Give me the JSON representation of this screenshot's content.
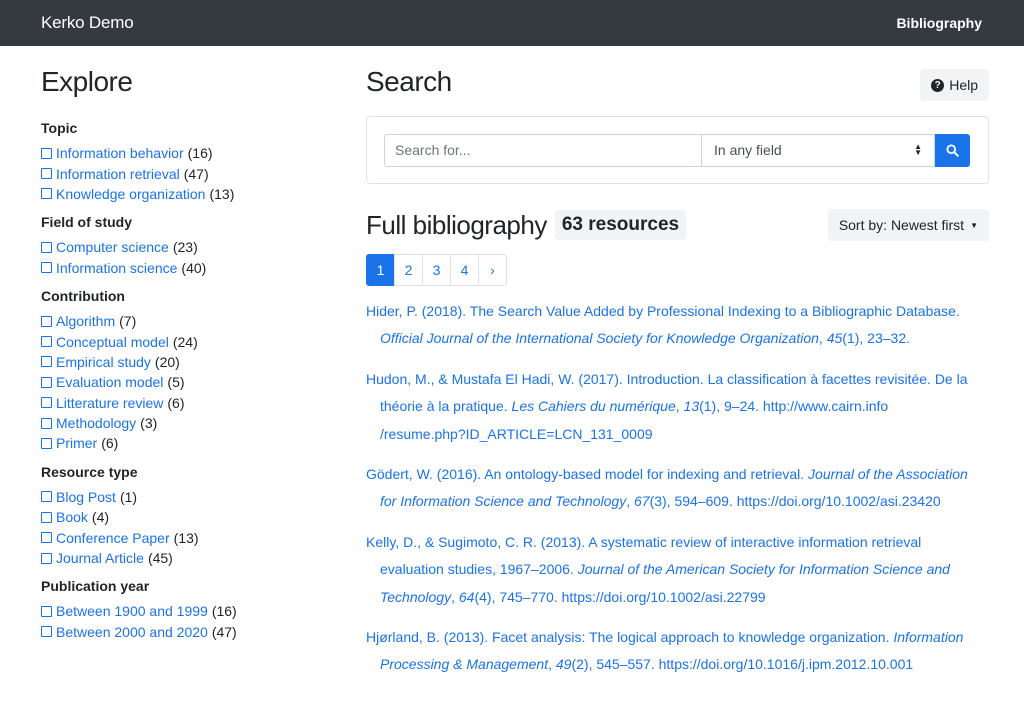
{
  "navbar": {
    "brand": "Kerko Demo",
    "link": "Bibliography"
  },
  "sidebar": {
    "title": "Explore",
    "facets": [
      {
        "title": "Topic",
        "items": [
          {
            "label": "Information behavior",
            "count": "(16)"
          },
          {
            "label": "Information retrieval",
            "count": "(47)"
          },
          {
            "label": "Knowledge organization",
            "count": "(13)"
          }
        ]
      },
      {
        "title": "Field of study",
        "items": [
          {
            "label": "Computer science",
            "count": "(23)"
          },
          {
            "label": "Information science",
            "count": "(40)"
          }
        ]
      },
      {
        "title": "Contribution",
        "items": [
          {
            "label": "Algorithm",
            "count": "(7)"
          },
          {
            "label": "Conceptual model",
            "count": "(24)"
          },
          {
            "label": "Empirical study",
            "count": "(20)"
          },
          {
            "label": "Evaluation model",
            "count": "(5)"
          },
          {
            "label": "Litterature review",
            "count": "(6)"
          },
          {
            "label": "Methodology",
            "count": "(3)"
          },
          {
            "label": "Primer",
            "count": "(6)"
          }
        ]
      },
      {
        "title": "Resource type",
        "items": [
          {
            "label": "Blog Post",
            "count": "(1)"
          },
          {
            "label": "Book",
            "count": "(4)"
          },
          {
            "label": "Conference Paper",
            "count": "(13)"
          },
          {
            "label": "Journal Article",
            "count": "(45)"
          }
        ]
      },
      {
        "title": "Publication year",
        "items": [
          {
            "label": "Between 1900 and 1999",
            "count": "(16)"
          },
          {
            "label": "Between 2000 and 2020",
            "count": "(47)"
          }
        ]
      }
    ]
  },
  "search": {
    "title": "Search",
    "help_label": "Help",
    "placeholder": "Search for...",
    "field_select": "In any field"
  },
  "results": {
    "title": "Full bibliography",
    "count_badge": "63 resources",
    "sort_label": "Sort by: Newest first",
    "pages": [
      "1",
      "2",
      "3",
      "4",
      "›"
    ],
    "active_page": "1",
    "items": [
      {
        "line1": "Hider, P. (2018). The Search Value Added by Professional Indexing to a Bibliographic Database.",
        "journal": "Official Journal of the International Society for Knowledge Organization",
        "sep1": ", ",
        "volume": "45",
        "rest": "(1), 23–32."
      },
      {
        "line1": "Hudon, M., & Mustafa El Hadi, W. (2017). Introduction. La classification à facettes revisitée. De la",
        "line2_pre": "théorie à la pratique. ",
        "journal": "Les Cahiers du numérique",
        "sep1": ", ",
        "volume": "13",
        "rest": "(1), 9–24. http://www.cairn.info",
        "line3": "/resume.php?ID_ARTICLE=LCN_131_0009"
      },
      {
        "line1_pre": "Gödert, W. (2016). An ontology-based model for indexing and retrieval. ",
        "line1_journal": "Journal of the Association",
        "journal": "for Information Science and Technology",
        "sep1": ", ",
        "volume": "67",
        "rest": "(3), 594–609. https://doi.org/10.1002/asi.23420"
      },
      {
        "line1": "Kelly, D., & Sugimoto, C. R. (2013). A systematic review of interactive information retrieval",
        "line2_pre": "evaluation studies, 1967–2006. ",
        "line2_journal": "Journal of the American Society for Information Science and",
        "journal": "Technology",
        "sep1": ", ",
        "volume": "64",
        "rest": "(4), 745–770. https://doi.org/10.1002/asi.22799"
      },
      {
        "line1_pre": "Hjørland, B. (2013). Facet analysis: The logical approach to knowledge organization. ",
        "line1_journal": "Information",
        "journal": "Processing & Management",
        "sep1": ", ",
        "volume": "49",
        "rest": "(2), 545–557. https://doi.org/10.1016/j.ipm.2012.10.001"
      }
    ]
  },
  "colors": {
    "navbar": "#343a40",
    "accent": "#1a73e8",
    "badge_bg": "#f1f3f5"
  },
  "icons": {
    "help": "question-circle-icon",
    "search": "search-icon",
    "sort": "caret-down-icon",
    "next": "chevron-right-icon"
  }
}
